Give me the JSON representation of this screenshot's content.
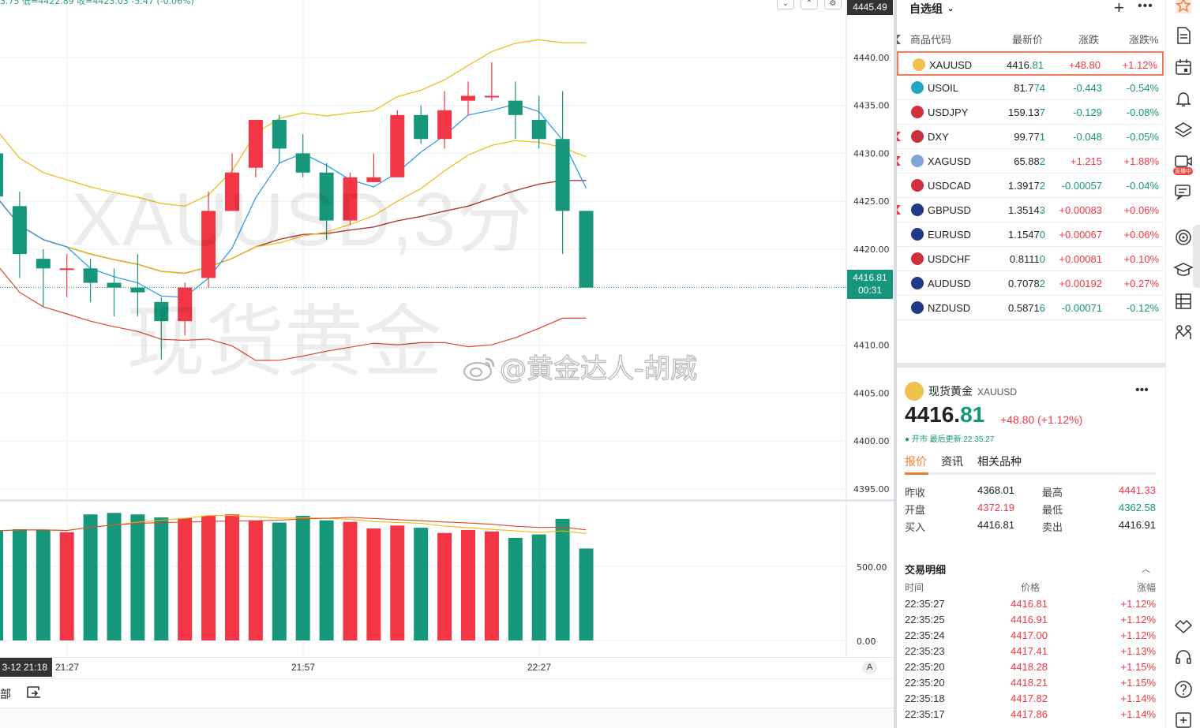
{
  "chart": {
    "symbol_watermark": "XAUUSD,3分",
    "name_watermark": "现货黄金",
    "social_watermark": "@黄金达人-胡威",
    "header_text": "3.75  低=4422.89  收=4423.03  -5.47  (-0.06%)",
    "top_price_tag": "4445.49",
    "current_price_tag": "4416.81",
    "countdown": "00:31",
    "price_axis_labels": [
      "4440.00",
      "4435.00",
      "4430.00",
      "4425.00",
      "4420.00",
      "4410.00",
      "4405.00",
      "4400.00",
      "4395.00"
    ],
    "volume_axis_labels": [
      "500.00",
      "0.00"
    ],
    "time_axis_date": "3-12  21:18",
    "time_axis_labels": [
      "21:27",
      "21:57",
      "22:27"
    ],
    "auto_scale_label": "A",
    "bottom_tool_label": "部",
    "colors": {
      "up": "#f23645",
      "down": "#16967a",
      "bb_upper": "#f0b90b",
      "bb_lower": "#e0452b",
      "ma_fast": "#2196f3",
      "ma_mid": "#f0b90b",
      "ma_slow": "#b03a3a"
    }
  },
  "chart_data": {
    "type": "candlestick",
    "symbol": "XAUUSD",
    "interval": "3分",
    "y_range": [
      4394,
      4446
    ],
    "candles": [
      {
        "o": 4430.0,
        "h": 4432.0,
        "c": 4425.5,
        "l": 4423.5
      },
      {
        "o": 4424.5,
        "h": 4426.0,
        "c": 4419.5,
        "l": 4417.0
      },
      {
        "o": 4419.0,
        "h": 4420.0,
        "c": 4418.0,
        "l": 4414.0
      },
      {
        "o": 4418.0,
        "h": 4419.5,
        "c": 4418.0,
        "l": 4415.0
      },
      {
        "o": 4418.0,
        "h": 4419.0,
        "c": 4416.5,
        "l": 4414.5
      },
      {
        "o": 4416.5,
        "h": 4418.0,
        "c": 4416.0,
        "l": 4413.0
      },
      {
        "o": 4416.0,
        "h": 4419.5,
        "c": 4415.5,
        "l": 4413.0
      },
      {
        "o": 4414.5,
        "h": 4415.0,
        "c": 4412.5,
        "l": 4408.5
      },
      {
        "o": 4412.5,
        "h": 4416.5,
        "c": 4416.0,
        "l": 4411.0
      },
      {
        "o": 4417.0,
        "h": 4426.0,
        "c": 4424.0,
        "l": 4416.0
      },
      {
        "o": 4424.0,
        "h": 4430.0,
        "c": 4428.0,
        "l": 4424.0
      },
      {
        "o": 4428.5,
        "h": 4433.5,
        "c": 4433.5,
        "l": 4427.5
      },
      {
        "o": 4433.5,
        "h": 4434.0,
        "c": 4430.5,
        "l": 4429.0
      },
      {
        "o": 4430.0,
        "h": 4432.0,
        "c": 4428.0,
        "l": 4427.5
      },
      {
        "o": 4428.0,
        "h": 4429.0,
        "c": 4423.0,
        "l": 4421.0
      },
      {
        "o": 4423.0,
        "h": 4428.0,
        "c": 4427.5,
        "l": 4422.5
      },
      {
        "o": 4427.0,
        "h": 4430.0,
        "c": 4427.5,
        "l": 4427.0
      },
      {
        "o": 4427.5,
        "h": 4434.5,
        "c": 4434.0,
        "l": 4427.5
      },
      {
        "o": 4434.0,
        "h": 4435.0,
        "c": 4431.5,
        "l": 4431.0
      },
      {
        "o": 4431.5,
        "h": 4436.5,
        "c": 4434.5,
        "l": 4430.5
      },
      {
        "o": 4435.5,
        "h": 4437.5,
        "c": 4436.0,
        "l": 4434.0
      },
      {
        "o": 4436.0,
        "h": 4439.5,
        "c": 4436.0,
        "l": 4435.5
      },
      {
        "o": 4435.5,
        "h": 4437.5,
        "c": 4434.0,
        "l": 4431.5
      },
      {
        "o": 4433.5,
        "h": 4436.0,
        "c": 4431.5,
        "l": 4430.5
      },
      {
        "o": 4431.5,
        "h": 4436.5,
        "c": 4424.0,
        "l": 4419.5
      },
      {
        "o": 4424.0,
        "h": 4424.0,
        "c": 4416.0,
        "l": 4416.0
      }
    ],
    "volume": [
      740,
      750,
      747,
      730,
      850,
      860,
      850,
      830,
      825,
      840,
      850,
      810,
      795,
      840,
      810,
      800,
      755,
      775,
      760,
      725,
      745,
      735,
      692,
      715,
      820,
      620
    ],
    "volume_axis_max": 1000
  },
  "watchlist": {
    "title": "自选组",
    "columns": [
      "商品代码",
      "最新价",
      "涨跌",
      "涨跌%"
    ],
    "rows": [
      {
        "symbol": "XAUUSD",
        "last_main": "4416.",
        "last_tail": "81",
        "change": "+48.80",
        "pct": "+1.12%",
        "dir": "up",
        "flag": false,
        "icon": "gold-icon",
        "icon_color": "#f0c14b"
      },
      {
        "symbol": "USOIL",
        "last_main": "81.7",
        "last_tail": "74",
        "change": "-0.443",
        "pct": "-0.54%",
        "dir": "down",
        "flag": false,
        "icon": "oil-icon",
        "icon_color": "#1ea7c5"
      },
      {
        "symbol": "USDJPY",
        "last_main": "159.13",
        "last_tail": "7",
        "change": "-0.129",
        "pct": "-0.08%",
        "dir": "down",
        "flag": false,
        "icon": "us-flag-icon",
        "icon_color": "#d22f3a"
      },
      {
        "symbol": "DXY",
        "last_main": "99.77",
        "last_tail": "1",
        "change": "-0.048",
        "pct": "-0.05%",
        "dir": "down",
        "flag": true,
        "icon": "us-flag-icon",
        "icon_color": "#c9303b"
      },
      {
        "symbol": "XAGUSD",
        "last_main": "65.88",
        "last_tail": "2",
        "change": "+1.215",
        "pct": "+1.88%",
        "dir": "up",
        "flag": true,
        "icon": "silver-icon",
        "icon_color": "#7fa7d6"
      },
      {
        "symbol": "USDCAD",
        "last_main": "1.3917",
        "last_tail": "2",
        "change": "-0.00057",
        "pct": "-0.04%",
        "dir": "down",
        "flag": false,
        "icon": "us-flag-icon",
        "icon_color": "#d22f3a"
      },
      {
        "symbol": "GBPUSD",
        "last_main": "1.3514",
        "last_tail": "3",
        "change": "+0.00083",
        "pct": "+0.06%",
        "dir": "up",
        "flag": true,
        "icon": "uk-flag-icon",
        "icon_color": "#1f3a8a"
      },
      {
        "symbol": "EURUSD",
        "last_main": "1.1547",
        "last_tail": "0",
        "change": "+0.00067",
        "pct": "+0.06%",
        "dir": "up",
        "flag": false,
        "icon": "eu-flag-icon",
        "icon_color": "#1f3a8a"
      },
      {
        "symbol": "USDCHF",
        "last_main": "0.8111",
        "last_tail": "0",
        "change": "+0.00081",
        "pct": "+0.10%",
        "dir": "up",
        "flag": false,
        "icon": "us-flag-icon",
        "icon_color": "#d22f3a"
      },
      {
        "symbol": "AUDUSD",
        "last_main": "0.7078",
        "last_tail": "2",
        "change": "+0.00192",
        "pct": "+0.27%",
        "dir": "up",
        "flag": false,
        "icon": "au-flag-icon",
        "icon_color": "#1f3a8a"
      },
      {
        "symbol": "NZDUSD",
        "last_main": "0.5871",
        "last_tail": "6",
        "change": "-0.00071",
        "pct": "-0.12%",
        "dir": "down",
        "flag": false,
        "icon": "nz-flag-icon",
        "icon_color": "#1f3a8a"
      }
    ]
  },
  "detail": {
    "name": "现货黄金",
    "symbol": "XAUUSD",
    "price_main": "4416.",
    "price_tail": "81",
    "change": "+48.80 (+1.12%)",
    "status": "● 开市 最后更新:22:35:27",
    "tabs": [
      "报价",
      "资讯",
      "相关品种"
    ],
    "quote": [
      {
        "k1": "昨收",
        "v1": "4368.01",
        "c1": "#222",
        "k2": "最高",
        "v2": "4441.33",
        "c2": "#f23645"
      },
      {
        "k1": "开盘",
        "v1": "4372.19",
        "c1": "#f23645",
        "k2": "最低",
        "v2": "4362.58",
        "c2": "#16967a"
      },
      {
        "k1": "买入",
        "v1": "4416.81",
        "c1": "#222",
        "k2": "卖出",
        "v2": "4416.91",
        "c2": "#222"
      }
    ],
    "trades_title": "交易明细",
    "trades_columns": [
      "时间",
      "价格",
      "涨幅"
    ],
    "trades": [
      {
        "time": "22:35:27",
        "price": "4416.81",
        "pct": "+1.12%"
      },
      {
        "time": "22:35:25",
        "price": "4416.91",
        "pct": "+1.12%"
      },
      {
        "time": "22:35:24",
        "price": "4417.00",
        "pct": "+1.12%"
      },
      {
        "time": "22:35:23",
        "price": "4417.41",
        "pct": "+1.13%"
      },
      {
        "time": "22:35:20",
        "price": "4418.28",
        "pct": "+1.15%"
      },
      {
        "time": "22:35:20",
        "price": "4418.21",
        "pct": "+1.15%"
      },
      {
        "time": "22:35:18",
        "price": "4417.82",
        "pct": "+1.14%"
      },
      {
        "time": "22:35:17",
        "price": "4417.86",
        "pct": "+1.14%"
      }
    ]
  },
  "sidebar": {
    "icons": [
      "watchlist-star-icon",
      "document-icon",
      "calendar-icon",
      "alert-bell-icon",
      "layers-icon",
      "live-video-icon",
      "chat-icon",
      "target-icon",
      "education-icon",
      "table-icon",
      "community-icon",
      "handshake-icon",
      "headset-icon",
      "help-icon",
      "settings-icon"
    ],
    "live_badge": "直播中"
  }
}
